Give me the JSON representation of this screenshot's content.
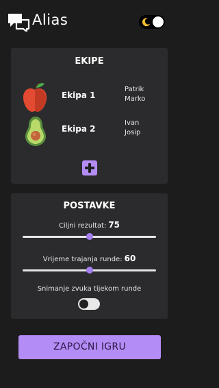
{
  "header": {
    "app_title": "Alias"
  },
  "teams": {
    "title": "EKIPE",
    "items": [
      {
        "name": "Ekipa 1",
        "icon": "apple-icon",
        "members": [
          "Patrik",
          "Marko"
        ]
      },
      {
        "name": "Ekipa 2",
        "icon": "avocado-icon",
        "members": [
          "Ivan",
          "Josip"
        ]
      }
    ]
  },
  "settings": {
    "title": "POSTAVKE",
    "target_score": {
      "label": "Ciljni rezultat:",
      "value": "75",
      "fraction": 0.5
    },
    "round_duration": {
      "label": "Vrijeme trajanja runde:",
      "value": "60",
      "fraction": 0.5
    },
    "sound_recording": {
      "label": "Snimanje zvuka tijekom runde",
      "enabled": false
    }
  },
  "start_button": {
    "label": "ZAPOČNI IGRU"
  },
  "colors": {
    "accent": "#b48cf5",
    "card": "#2b2b2d",
    "background": "#1c1c1c"
  }
}
